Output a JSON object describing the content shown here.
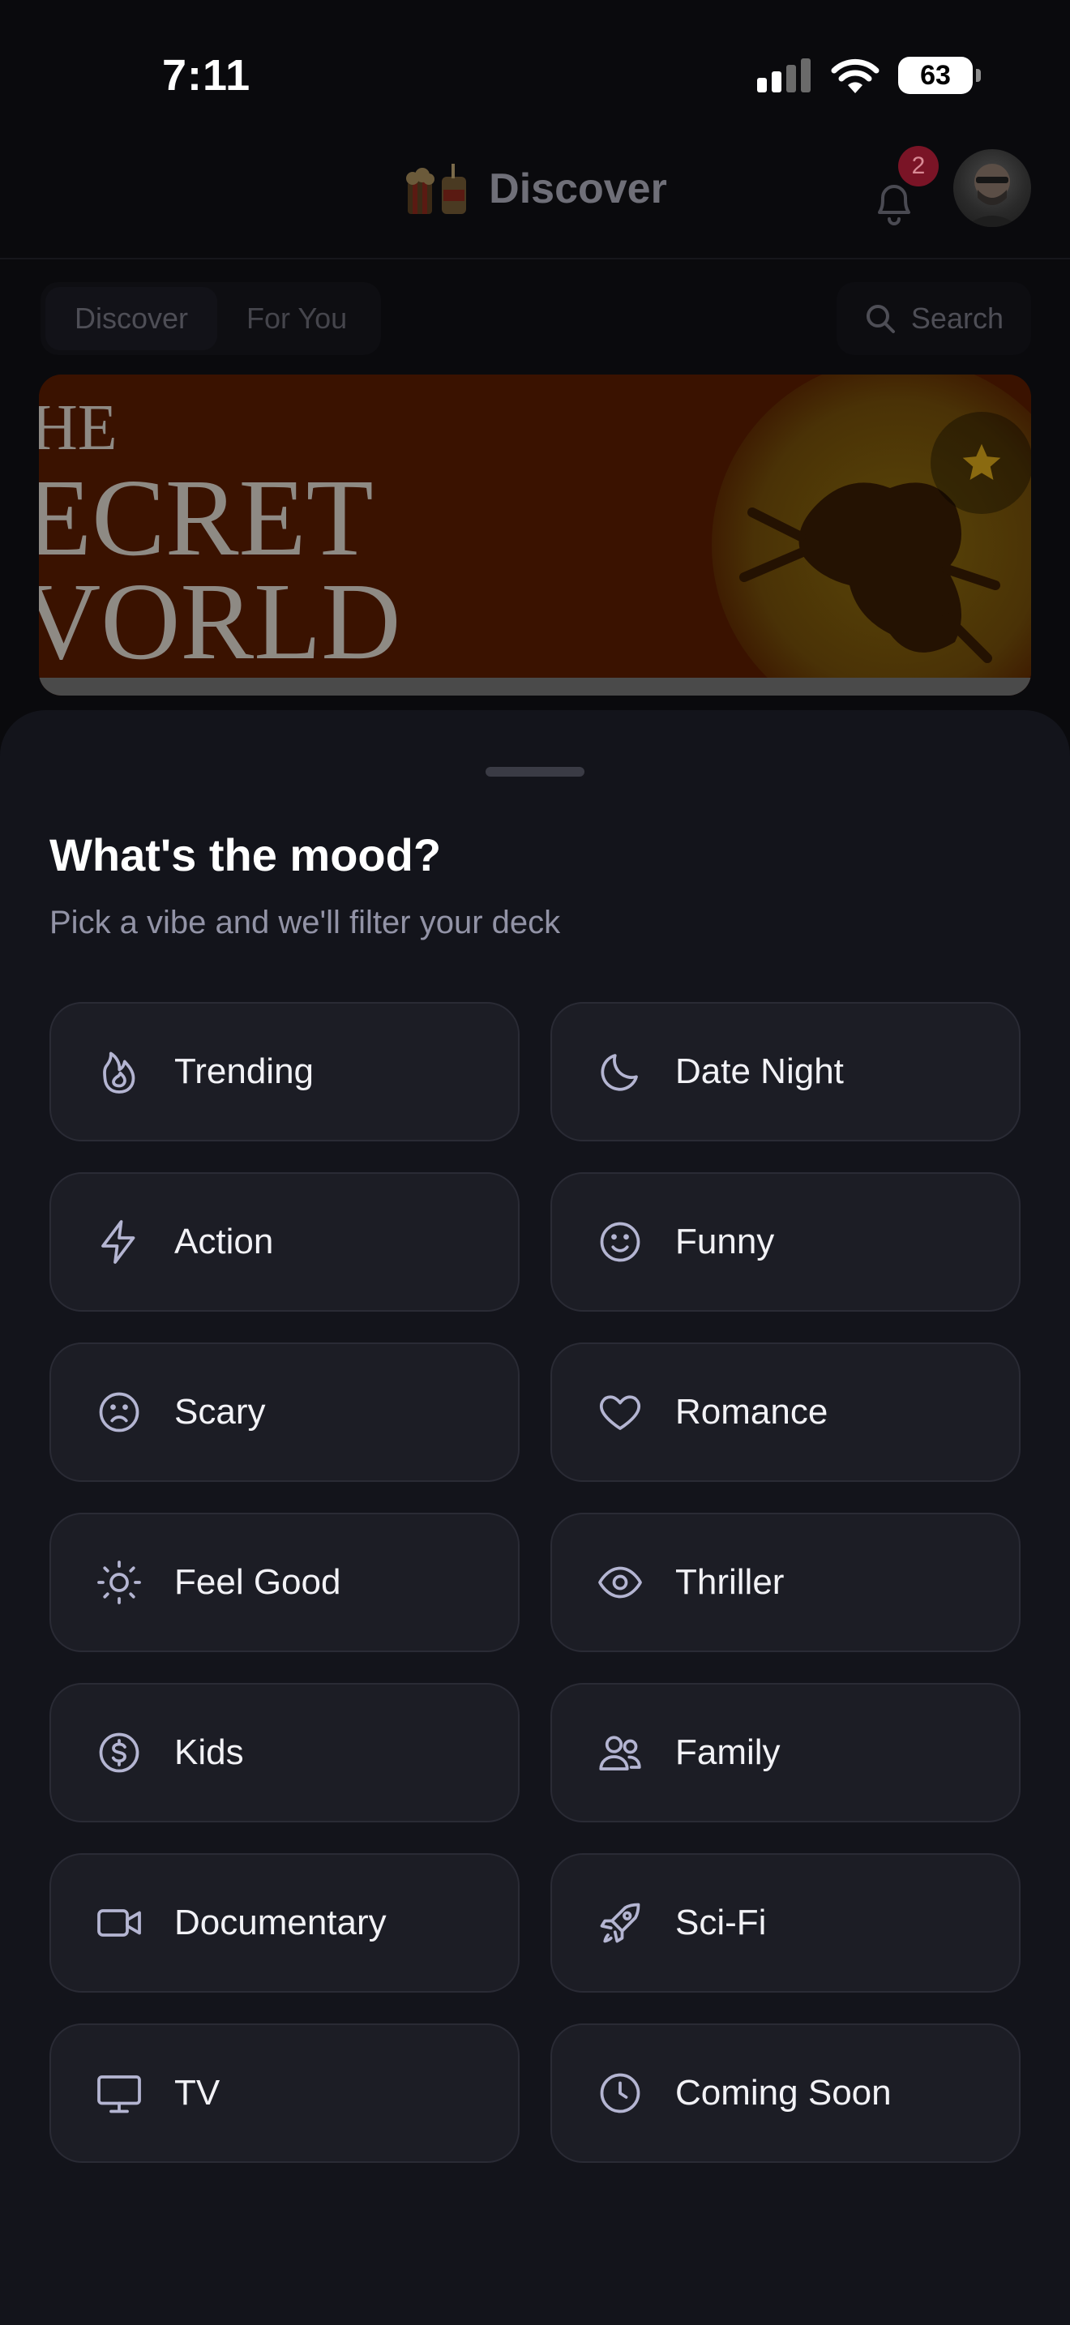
{
  "status_bar": {
    "time": "7:11",
    "battery": "63"
  },
  "header": {
    "title": "Discover",
    "notification_count": "2"
  },
  "tabs": [
    {
      "label": "Discover",
      "active": true
    },
    {
      "label": "For You",
      "active": false
    }
  ],
  "search": {
    "label": "Search"
  },
  "hero": {
    "poster_text": [
      "HE",
      "ECRET",
      "VORLD"
    ]
  },
  "sheet": {
    "title": "What's the mood?",
    "subtitle": "Pick a vibe and we'll filter your deck",
    "moods": [
      {
        "label": "Trending",
        "icon": "flame-icon"
      },
      {
        "label": "Date Night",
        "icon": "moon-icon"
      },
      {
        "label": "Action",
        "icon": "lightning-icon"
      },
      {
        "label": "Funny",
        "icon": "smile-icon"
      },
      {
        "label": "Scary",
        "icon": "frown-icon"
      },
      {
        "label": "Romance",
        "icon": "heart-icon"
      },
      {
        "label": "Feel Good",
        "icon": "sun-icon"
      },
      {
        "label": "Thriller",
        "icon": "eye-icon"
      },
      {
        "label": "Kids",
        "icon": "dollar-circle-icon"
      },
      {
        "label": "Family",
        "icon": "users-icon"
      },
      {
        "label": "Documentary",
        "icon": "video-camera-icon"
      },
      {
        "label": "Sci-Fi",
        "icon": "rocket-icon"
      },
      {
        "label": "TV",
        "icon": "monitor-icon"
      },
      {
        "label": "Coming Soon",
        "icon": "clock-icon"
      }
    ]
  },
  "colors": {
    "background": "#0a0a0d",
    "sheet": "#13141b",
    "button": "#1c1d25",
    "icon_stroke": "#b4b5d2",
    "badge": "#7a1426"
  }
}
